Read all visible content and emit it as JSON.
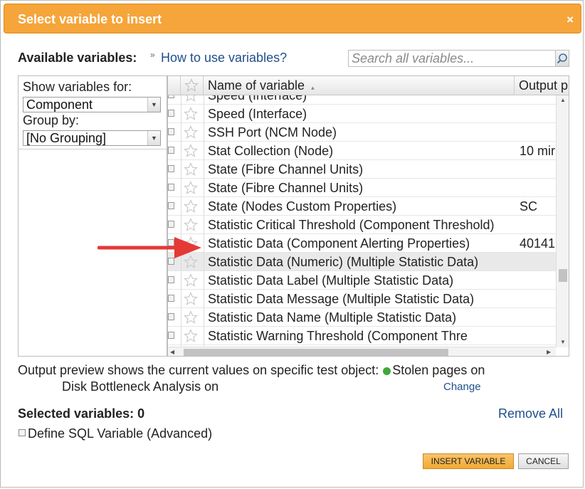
{
  "dialog": {
    "title": "Select variable to insert",
    "close": "×"
  },
  "available": {
    "label": "Available variables:",
    "separator": "»",
    "howto": "How to use variables?"
  },
  "search": {
    "placeholder": "Search all variables..."
  },
  "left": {
    "show_label": "Show variables for:",
    "show_value": "Component",
    "group_label": "Group by:",
    "group_value": "[No Grouping]"
  },
  "grid": {
    "col_name": "Name of variable",
    "sort_indicator": "▴",
    "col_output": "Output p",
    "rows": [
      {
        "name": "Speed (Interface)",
        "output": ""
      },
      {
        "name": "Speed (Interface)",
        "output": ""
      },
      {
        "name": "SSH Port (NCM Node)",
        "output": ""
      },
      {
        "name": "Stat Collection (Node)",
        "output": "10 mir"
      },
      {
        "name": "State (Fibre Channel Units)",
        "output": ""
      },
      {
        "name": "State (Fibre Channel Units)",
        "output": ""
      },
      {
        "name": "State (Nodes Custom Properties)",
        "output": "SC"
      },
      {
        "name": "Statistic Critical Threshold (Component Threshold)",
        "output": ""
      },
      {
        "name": "Statistic Data (Component Alerting Properties)",
        "output": "40141"
      },
      {
        "name": "Statistic Data (Numeric) (Multiple Statistic Data)",
        "output": ""
      },
      {
        "name": "Statistic Data Label (Multiple Statistic Data)",
        "output": ""
      },
      {
        "name": "Statistic Data Message (Multiple Statistic Data)",
        "output": ""
      },
      {
        "name": "Statistic Data Name (Multiple Statistic Data)",
        "output": ""
      },
      {
        "name": "Statistic Warning Threshold (Component Thre",
        "output": ""
      }
    ]
  },
  "preview": {
    "line1": "Output preview shows the current values on specific test object:",
    "object": "Stolen pages on",
    "line2": "Disk Bottleneck Analysis on",
    "change": "Change"
  },
  "selected": {
    "label": "Selected variables: 0",
    "remove": "Remove All"
  },
  "sql": {
    "label": "Define SQL Variable (Advanced)"
  },
  "buttons": {
    "insert": "INSERT VARIABLE",
    "cancel": "CANCEL"
  },
  "colors": {
    "accent": "#f5a53a",
    "link": "#1f4f8b",
    "pointer_arrow": "#e53935"
  }
}
